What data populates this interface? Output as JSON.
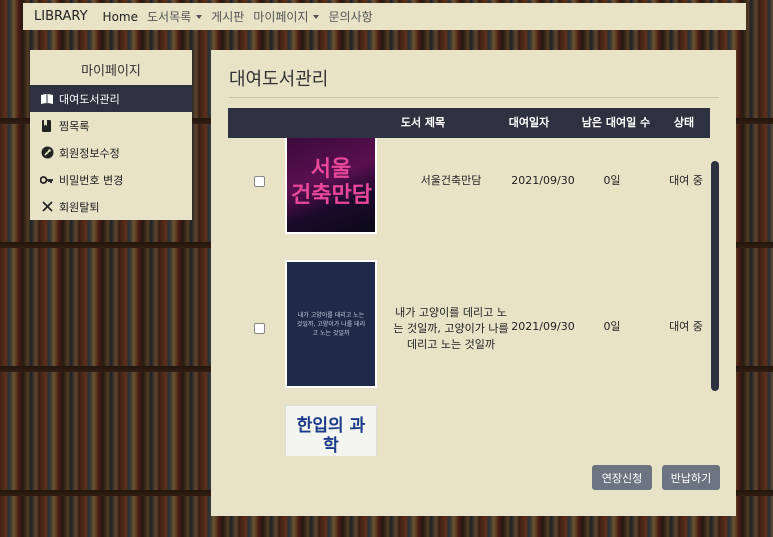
{
  "navbar": {
    "brand": "LIBRARY",
    "items": [
      {
        "label": "Home"
      },
      {
        "label": "도서목록"
      },
      {
        "label": "게시판"
      },
      {
        "label": "마이페이지"
      },
      {
        "label": "문의사항"
      }
    ]
  },
  "sidebar": {
    "title": "마이페이지",
    "items": [
      {
        "label": "대여도서관리",
        "icon": "book-open-icon"
      },
      {
        "label": "찜목록",
        "icon": "bookmark-icon"
      },
      {
        "label": "회원정보수정",
        "icon": "wrench-icon"
      },
      {
        "label": "비밀번호 변경",
        "icon": "key-icon"
      },
      {
        "label": "회원탈퇴",
        "icon": "close-icon"
      }
    ]
  },
  "main": {
    "title": "대여도서관리",
    "columns": [
      "도서 제목",
      "대여일자",
      "남은 대여일 수",
      "상태"
    ],
    "rows": [
      {
        "title": "서울건축만담",
        "date": "2021/09/30",
        "remaining": "0일",
        "status": "대여 중",
        "cover_text": "서울 건축만담"
      },
      {
        "title": "내가 고양이를 데리고 노는 것일까, 고양이가 나를 데리고 노는 것일까",
        "date": "2021/09/30",
        "remaining": "0일",
        "status": "대여 중",
        "cover_text": "내가 고양이를 데리고 노는 것일까, 고양이가 나를 데리고 노는 것일까"
      },
      {
        "cover_text": "한입의 과학"
      }
    ],
    "buttons": {
      "extend": "연장신청",
      "return": "반납하기"
    }
  },
  "colors": {
    "panel": "#e8e2c6",
    "header": "#2e3240",
    "button": "#6b7480"
  }
}
